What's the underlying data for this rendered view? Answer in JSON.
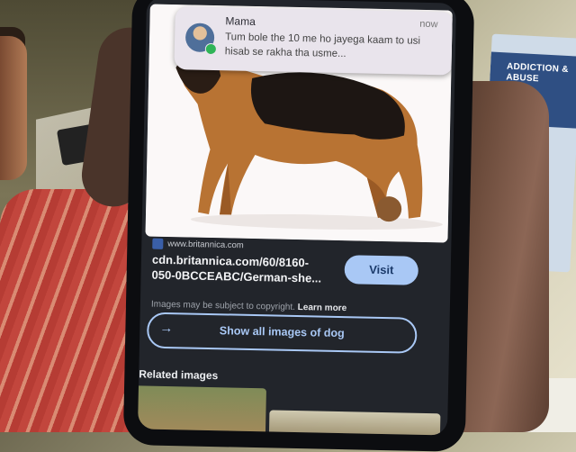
{
  "notification": {
    "sender": "Mama",
    "time": "now",
    "message": "Tum bole the 10 me ho jayega kaam to usi hisab se rakha tha usme..."
  },
  "result": {
    "source": "www.britannica.com",
    "link_text": "cdn.britannica.com/60/8160-050-0BCCEABC/German-she...",
    "visit_label": "Visit",
    "copyright_text": "Images may be subject to copyright.",
    "learn_more": "Learn more"
  },
  "show_all_label": "Show all images of dog",
  "related_label": "Related images",
  "poster_text": "ADDICTION &\nABUSE",
  "colors": {
    "screen_bg": "#22252b",
    "accent": "#a9c8f5",
    "notification_bg": "#e9e4ec"
  }
}
